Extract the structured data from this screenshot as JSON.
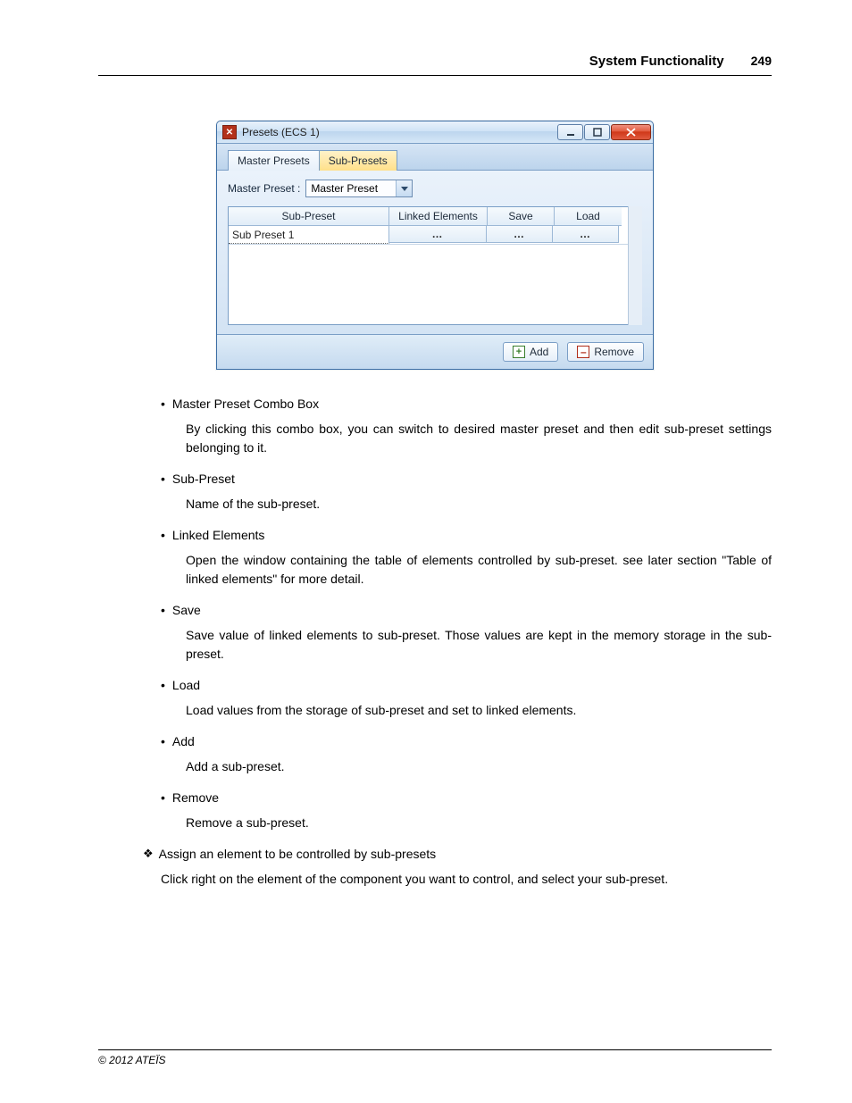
{
  "header": {
    "title": "System Functionality",
    "page": "249"
  },
  "window": {
    "title": "Presets (ECS 1)",
    "tabs": [
      "Master Presets",
      "Sub-Presets"
    ],
    "active_tab": 1,
    "combo_label": "Master Preset :",
    "combo_value": "Master Preset",
    "columns": [
      "Sub-Preset",
      "Linked Elements",
      "Save",
      "Load"
    ],
    "rows": [
      {
        "name": "Sub Preset 1",
        "linked": "…",
        "save": "…",
        "load": "…"
      }
    ],
    "add_label": "Add",
    "remove_label": "Remove"
  },
  "items": [
    {
      "title": "Master Preset Combo Box",
      "desc": "By clicking this combo box, you can switch to desired master preset and then edit sub-preset settings belonging to it."
    },
    {
      "title": "Sub-Preset",
      "desc": "Name of the sub-preset."
    },
    {
      "title": "Linked Elements",
      "desc": "Open the window containing the table of elements controlled by sub-preset. see later section \"Table of  linked elements\" for more detail."
    },
    {
      "title": "Save",
      "desc": "Save value of linked elements to sub-preset. Those values are kept in the memory storage in the sub-preset."
    },
    {
      "title": "Load",
      "desc": "Load values from the storage of sub-preset and set to linked elements."
    },
    {
      "title": "Add",
      "desc": "Add a sub-preset."
    },
    {
      "title": "Remove",
      "desc": "Remove a sub-preset."
    }
  ],
  "section": {
    "title": "Assign an element to be controlled by sub-presets",
    "desc": "Click right on the element of the component you want to control, and select your sub-preset."
  },
  "footer": "© 2012 ATEÏS"
}
